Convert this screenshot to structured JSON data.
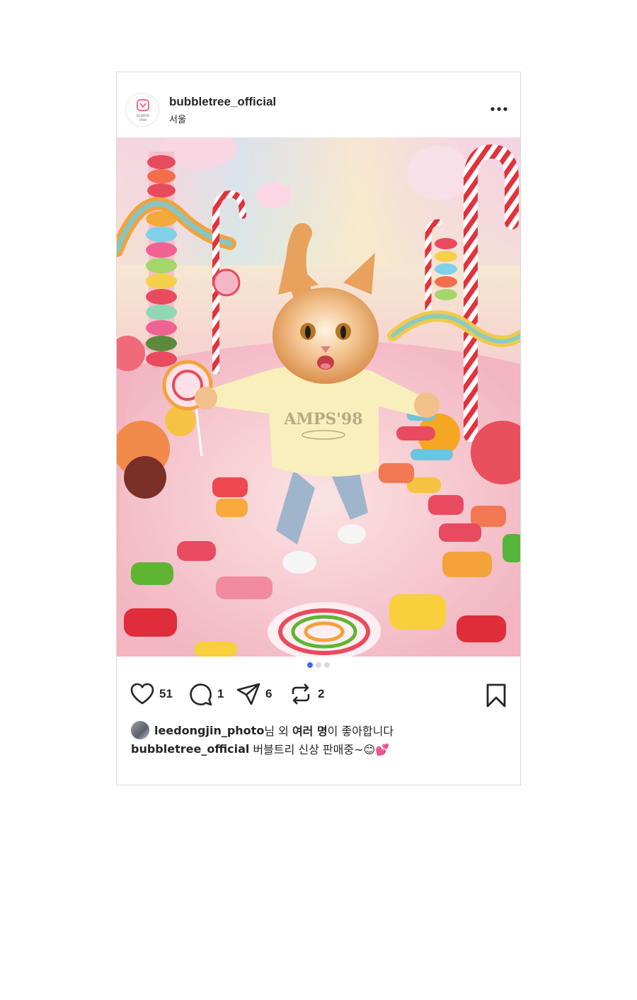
{
  "post": {
    "username": "bubbletree_official",
    "location": "서울",
    "avatar_logo_text": "bubble tree",
    "more_icon": "more-horizontal-icon",
    "carousel": {
      "total": 3,
      "active_index": 0
    },
    "actions": {
      "like_count": "51",
      "comment_count": "1",
      "share_count": "6",
      "repost_count": "2"
    },
    "likes": {
      "liker": "leedongjin_photo",
      "text_middle": "님 외 ",
      "others": "여러 명",
      "text_end": "이 좋아합니다"
    },
    "caption": {
      "author": "bubbletree_official",
      "text": "버블트리 신상 판매중~😊💕"
    },
    "image_subject": "orange tabby cat in yellow sweatshirt and jeans in candy land",
    "image_sweatshirt_text": "AMPS'98"
  },
  "colors": {
    "border": "#dbdbdb",
    "text": "#262626",
    "dot_active": "#3f6be8",
    "dot_inactive": "#dbdbdb",
    "brand_pink": "#f06a8c"
  }
}
